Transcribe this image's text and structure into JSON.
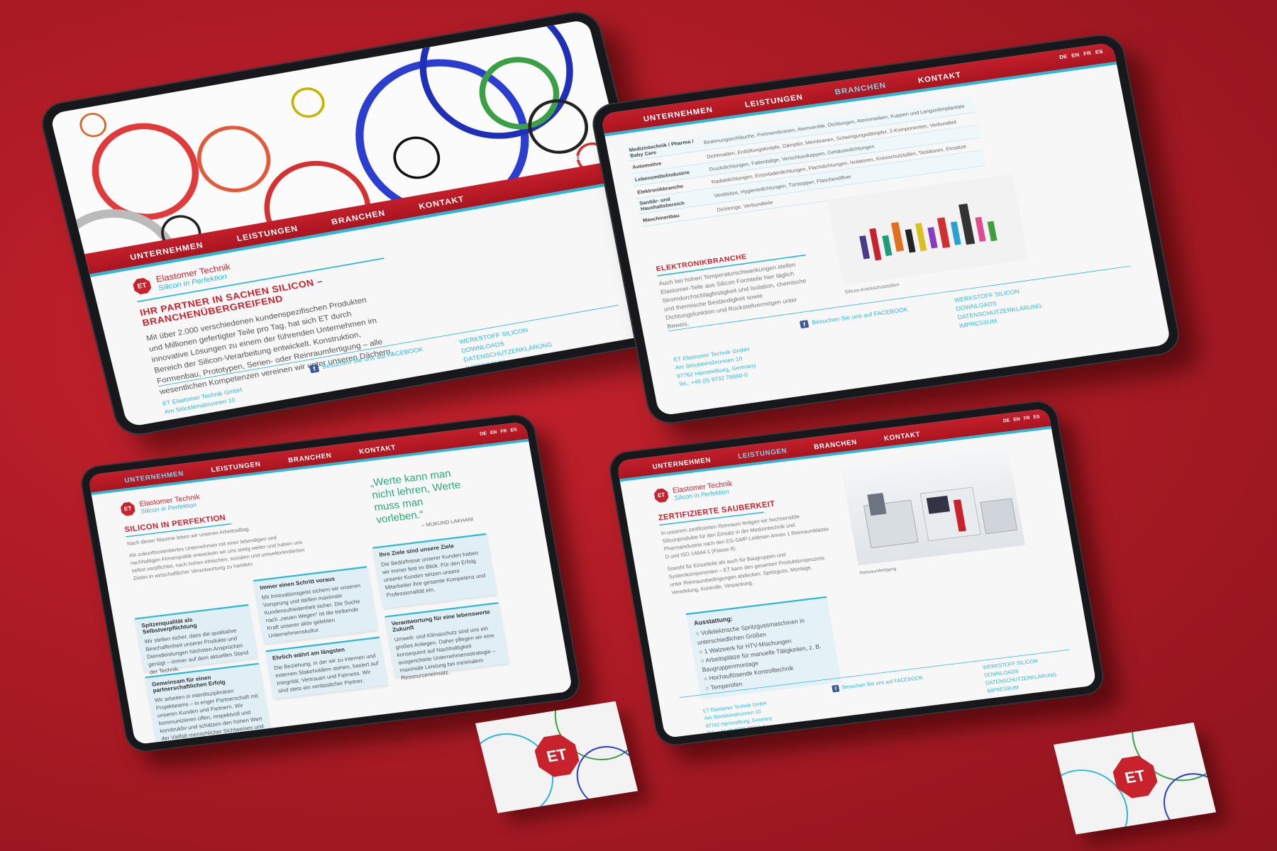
{
  "brand": {
    "logo_mark": "ET",
    "name": "Elastomer Technik",
    "tagline": "Silicon in Perfektion",
    "red": "#c8222d",
    "cyan": "#2bb8d6"
  },
  "nav": [
    "UNTERNEHMEN",
    "LEISTUNGEN",
    "BRANCHEN",
    "KONTAKT"
  ],
  "languages": [
    "DE",
    "EN",
    "FR",
    "ES"
  ],
  "footer": {
    "facebook": "Besuchen Sie uns auf FACEBOOK",
    "links": [
      "WERKSTOFF SILICON",
      "DOWNLOADS",
      "DATENSCHUTZERKLÄRUNG",
      "IMPRESSUM"
    ],
    "address": [
      "ET Elastomer Technik GmbH",
      "Am Stöckleinsbrunnen 10",
      "97762 Hammelburg, Germany",
      "Tel.: +49 (0) 9732 78860-0"
    ]
  },
  "home": {
    "heading_1": "IHR PARTNER IN SACHEN SILICON –",
    "heading_2": "BRANCHENÜBERGREIFEND",
    "paragraph": "Mit über 2.000 verschiedenen kundenspezifischen Produkten und Millionen gefertigter Teile pro Tag, hat sich ET durch innovative Lösungen zu einem der führenden Unternehmen im Bereich der Silicon-Verarbeitung entwickelt. Konstruktion, Formenbau, Prototypen, Serien- oder Reinraumfertigung – alle wesentlichen Kompetenzen vereinen wir unter unseren Dächern."
  },
  "branchen": {
    "rows": [
      {
        "cat": "Medizintechnik / Pharma / Baby Care",
        "items": "Beatmungsschläuche, Portmembranen, Atemventile, Dichtungen, Atemmasken, Kuppen und Langzeitimplantate"
      },
      {
        "cat": "Automotive",
        "items": "Dichtmatten, Entlüftungsknöpfe, Dämpfer, Membranen, Schwingungsdämpfer, 2-Komponenten, Verbundteil"
      },
      {
        "cat": "Lebensmittelindustrie",
        "items": "Druckdichtungen, Faltenbälge, Verschlusskappen, Gehäusedichtungen"
      },
      {
        "cat": "Elektronikbranche",
        "items": "Radialdichtungen, Einzeladerdichtungen, Flachdichtungen, Isolatoren, Kreisschutztüllen, Tastaturen, Einsätze"
      },
      {
        "cat": "Sanitär- und Haushaltsbereich",
        "items": "Ventilsitze, Hygienedichtungen, Türstopper, Flaschenöffner"
      },
      {
        "cat": "Maschinenbau",
        "items": "Dichtringe, Verbundteile"
      }
    ],
    "section_title": "ELEKTRONIKBRANCHE",
    "section_text": "Auch bei hohen Temperaturschwankungen stellen Elastomer-Teile aus Silicon Formteile hier täglich Stromdurchschlagfestigkeit und Isolation, chemische und thermische Beständigkeit sowie Dichtungsfunktion und Rückstellvermögen unter Beweis.",
    "image_caption": "Silicon-Knickschutztüllen"
  },
  "unternehmen": {
    "title": "SILICON IN PERFEKTION",
    "subtitle": "Nach dieser Maxime leben wir unseren Arbeitsalltag.",
    "intro": "Als zukunftsorientiertes Unternehmen mit einer lebendigen und nachhaltigen Firmenpolitik entwickeln wir uns stetig weiter und haben uns selbst verpflichtet, nach hohen ethischen, sozialen und umweltorientierten Zielen in wirtschaftlicher Verantwortung zu handeln.",
    "quote": "„Werte kann man nicht lehren, Werte muss man vorleben.“",
    "quote_author": "– MUKUND LAKHANI",
    "cards": [
      {
        "title": "Spitzenqualität als Selbstverpflichtung",
        "text": "Wir stellen sicher, dass die qualitative Beschaffenheit unserer Produkte und Dienstleistungen höchsten Ansprüchen genügt – immer auf dem aktuellen Stand der Technik."
      },
      {
        "title": "Immer einen Schritt voraus",
        "text": "Mit Innovationsgeist sichern wir unseren Vorsprung und stellen maximale Kundenzufriedenheit sicher. Die Suche nach „neuen Wegen“ ist die treibende Kraft unserer aktiv gelebten Unternehmenskultur."
      },
      {
        "title": "Ihre Ziele sind unsere Ziele",
        "text": "Die Bedürfnisse unserer Kunden haben wir immer fest im Blick. Für den Erfolg unserer Kunden setzen unsere Mitarbeiter ihre gesamte Kompetenz und Professionalität ein."
      },
      {
        "title": "Gemeinsam für einen partnerschaftlichen Erfolg",
        "text": "Wir arbeiten in interdisziplinären Projektteams – in enger Partnerschaft mit unseren Kunden und Partnern. Wir kommunizieren offen, respektvoll und konstruktiv und schätzen den hohen Wert der Vielfalt menschlicher Sichtweisen und Erfahrungen."
      },
      {
        "title": "Ehrlich währt am längsten",
        "text": "Die Beziehung, in der wir zu internen und externen Stakeholdern stehen, basiert auf Integrität, Vertrauen und Fairness. Wir sind stets ein verlässlicher Partner."
      },
      {
        "title": "Verantwortung für eine lebenswerte Zukunft",
        "text": "Umwelt- und Klimaschutz sind uns ein großes Anliegen. Daher pflegen wir eine konsequent auf Nachhaltigkeit ausgerichtete Unternehmensstrategie – maximale Leistung bei minimalem Ressourceneinsatz."
      }
    ]
  },
  "leistungen": {
    "title": "ZERTIFIZIERTE SAUBERKEIT",
    "paragraph_1": "In unserem zertifizierten Reinraum fertigen wir hochsensible Siliconprodukte für den Einsatz in der Medizintechnik und Pharmaindustrie nach den EG-GMP-Leitlinien Annex 1 Reinraumklasse D und ISO 14644-1 (Klasse 8).",
    "paragraph_2": "Sowohl für Einzelteile als auch für Baugruppen und Systemkomponenten – ET kann den gesamten Produktionsprozess unter Reinraumbedingungen abdecken: Spritzguss, Montage, Veredelung, Kontrolle, Verpackung.",
    "equipment_title": "Ausstattung:",
    "equipment": [
      "Vollelektrische Spritzgussmaschinen in unterschiedlichen Größen",
      "1 Walzwerk für HTV-Mischungen",
      "Arbeitsplätze für manuelle Tätigkeiten, z. B. Baugruppenmontage",
      "Hochauflösende Kontrolltechnik",
      "Temperöfen"
    ],
    "image_caption": "Reinraumfertigung"
  }
}
